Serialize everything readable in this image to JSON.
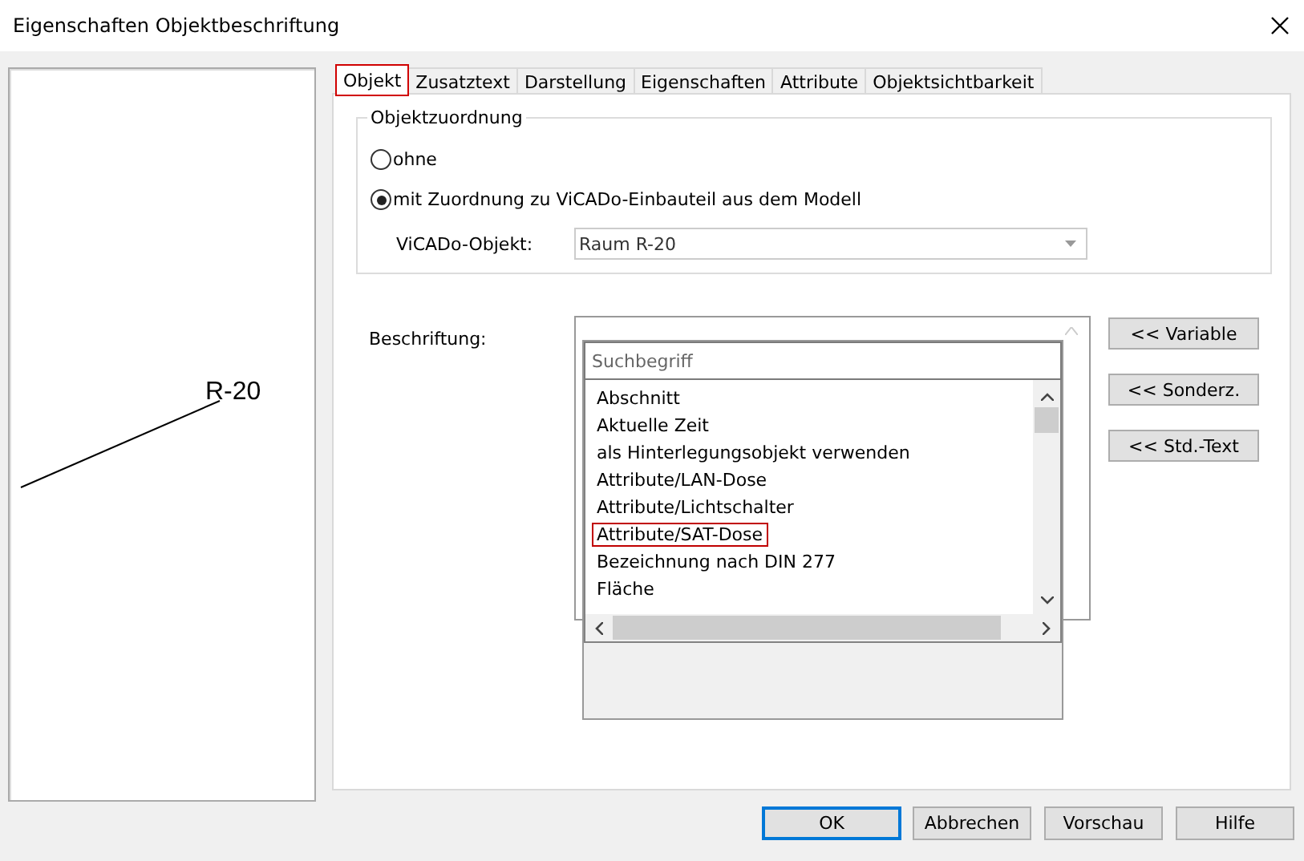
{
  "window": {
    "title": "Eigenschaften Objektbeschriftung"
  },
  "preview": {
    "label": "R-20"
  },
  "tabs": [
    {
      "label": "Objekt",
      "selected": true
    },
    {
      "label": "Zusatztext",
      "selected": false
    },
    {
      "label": "Darstellung",
      "selected": false
    },
    {
      "label": "Eigenschaften",
      "selected": false
    },
    {
      "label": "Attribute",
      "selected": false
    },
    {
      "label": "Objektsichtbarkeit",
      "selected": false
    }
  ],
  "group": {
    "title": "Objektzuordnung",
    "options": [
      {
        "label": "ohne",
        "selected": false
      },
      {
        "label": "mit Zuordnung zu ViCADo-Einbauteil aus dem Modell",
        "selected": true
      }
    ],
    "object_label": "ViCADo-Objekt:",
    "object_value": "Raum R-20"
  },
  "beschriftung": {
    "label": "Beschriftung:",
    "search": {
      "placeholder": "Suchbegriff"
    },
    "items": [
      {
        "label": "Abschnitt",
        "selected": false
      },
      {
        "label": "Aktuelle Zeit",
        "selected": false
      },
      {
        "label": "als Hinterlegungsobjekt verwenden",
        "selected": false
      },
      {
        "label": "Attribute/LAN-Dose",
        "selected": false
      },
      {
        "label": "Attribute/Lichtschalter",
        "selected": false
      },
      {
        "label": "Attribute/SAT-Dose",
        "selected": true
      },
      {
        "label": "Bezeichnung nach DIN 277",
        "selected": false
      },
      {
        "label": "Fläche",
        "selected": false
      }
    ]
  },
  "side_buttons": [
    "<< Variable",
    "<< Sonderz.",
    "<< Std.-Text"
  ],
  "buttons": [
    {
      "label": "OK",
      "default": true
    },
    {
      "label": "Abbrechen",
      "default": false
    },
    {
      "label": "Vorschau",
      "default": false
    },
    {
      "label": "Hilfe",
      "default": false
    }
  ]
}
